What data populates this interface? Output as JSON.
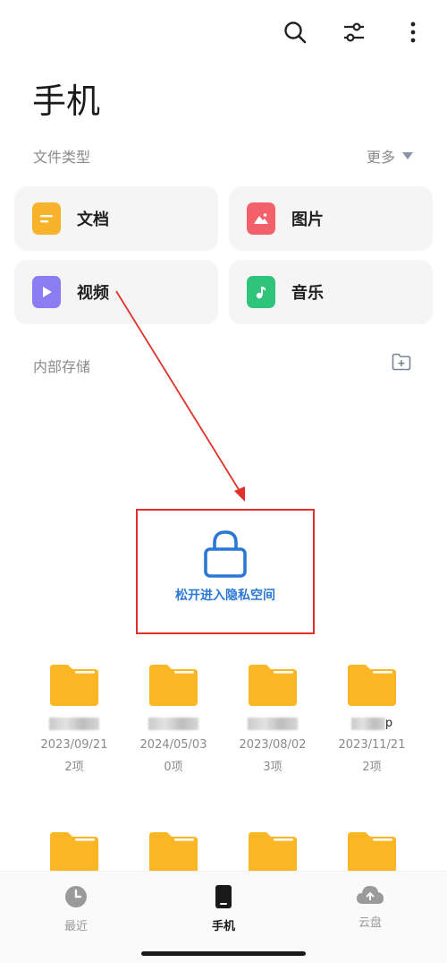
{
  "header": {
    "title": "手机"
  },
  "toolbar": {
    "search_icon": "search-icon",
    "filter_icon": "sliders-icon",
    "more_icon": "more-vertical-icon"
  },
  "file_types": {
    "label": "文件类型",
    "more_label": "更多",
    "items": [
      {
        "label": "文档",
        "icon": "document-icon",
        "color": "#f7b32b"
      },
      {
        "label": "图片",
        "icon": "image-icon",
        "color": "#f2616a"
      },
      {
        "label": "视频",
        "icon": "video-icon",
        "color": "#8b7cf2"
      },
      {
        "label": "音乐",
        "icon": "music-icon",
        "color": "#2fc47a"
      }
    ]
  },
  "storage": {
    "label": "内部存储"
  },
  "private_space": {
    "label": "松开进入隐私空间",
    "annotation_color": "#e0322b",
    "text_color": "#2a78d6"
  },
  "folders": [
    {
      "name": "",
      "date": "2023/09/21",
      "count": "2项"
    },
    {
      "name": "",
      "date": "2024/05/03",
      "count": "0项"
    },
    {
      "name": "",
      "date": "2023/08/02",
      "count": "3项"
    },
    {
      "name": "p",
      "date": "2023/11/21",
      "count": "2项"
    }
  ],
  "bottom_nav": [
    {
      "label": "最近",
      "active": false
    },
    {
      "label": "手机",
      "active": true
    },
    {
      "label": "云盘",
      "active": false
    }
  ],
  "colors": {
    "folder": "#fbb626",
    "folder_tab": "#f9a914"
  }
}
